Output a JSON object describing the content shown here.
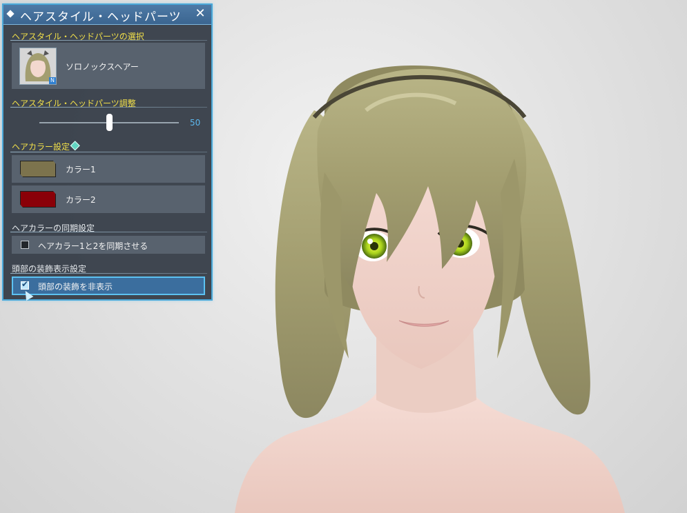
{
  "panel": {
    "title": "ヘアスタイル・ヘッドパーツ",
    "close_glyph": "✕",
    "selection": {
      "heading": "ヘアスタイル・ヘッドパーツの選択",
      "hair_name": "ソロノックスヘアー",
      "thumb_badge": "N"
    },
    "adjust": {
      "heading": "ヘアスタイル・ヘッドパーツ調整",
      "slider_value": "50",
      "slider_fraction": 0.5
    },
    "hair_color": {
      "heading": "ヘアカラー設定",
      "color1_label": "カラー1",
      "color1_hex": "#7c734d",
      "color2_label": "カラー2",
      "color2_hex": "#8a0008"
    },
    "sync": {
      "heading": "ヘアカラーの同期設定",
      "checkbox_label": "ヘアカラー1と2を同期させる",
      "checked": false
    },
    "head_deco": {
      "heading": "頭部の装飾表示設定",
      "checkbox_label": "頭部の装飾を非表示",
      "checked": true
    }
  },
  "colors": {
    "accent": "#4aa8d8",
    "heading_yellow": "#f2e04a",
    "slider_value": "#5cb8ee",
    "hair": "#a39e70"
  }
}
